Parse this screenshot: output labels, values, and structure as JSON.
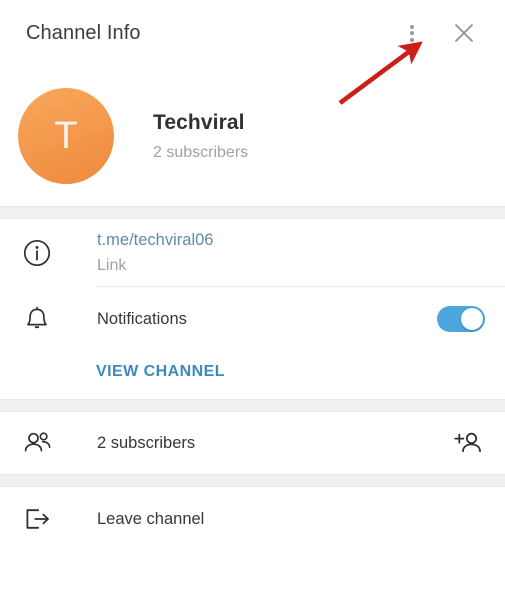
{
  "header": {
    "title": "Channel Info",
    "menu_icon": "kebab-menu-icon",
    "close_icon": "close-icon"
  },
  "profile": {
    "avatar_letter": "T",
    "avatar_gradient_from": "#f8a85c",
    "avatar_gradient_to": "#ef8a3e",
    "name": "Techviral",
    "subtitle": "2 subscribers"
  },
  "info_section": {
    "link": {
      "icon": "info-circle-icon",
      "value": "t.me/techviral06",
      "label": "Link",
      "color": "#5d8ca6"
    },
    "notifications": {
      "icon": "bell-icon",
      "label": "Notifications",
      "toggle_state": "on",
      "toggle_color": "#4ca5dd"
    },
    "view_channel": {
      "label": "VIEW CHANNEL",
      "color": "#3c8bbd"
    }
  },
  "members_section": {
    "subscribers": {
      "icon": "people-icon",
      "label": "2 subscribers",
      "action_icon": "add-person-icon"
    }
  },
  "leave_section": {
    "leave": {
      "icon": "exit-icon",
      "label": "Leave channel"
    }
  },
  "annotation": {
    "arrow_color": "#cc1f1a",
    "points_to": "kebab-menu-icon"
  }
}
